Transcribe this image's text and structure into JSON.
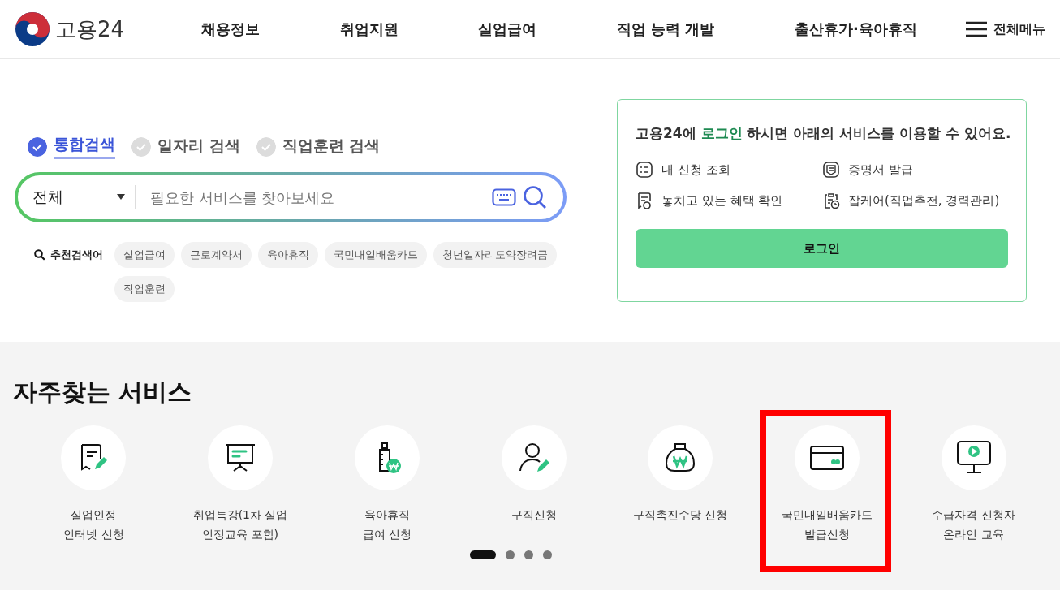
{
  "header": {
    "logo_text": "고용24",
    "nav": [
      "채용정보",
      "취업지원",
      "실업급여",
      "직업 능력 개발",
      "출산휴가·육아휴직"
    ],
    "menu_label": "전체메뉴"
  },
  "search": {
    "tabs": [
      {
        "label": "통합검색",
        "selected": true
      },
      {
        "label": "일자리 검색",
        "selected": false
      },
      {
        "label": "직업훈련 검색",
        "selected": false
      }
    ],
    "category": "전체",
    "placeholder": "필요한 서비스를 찾아보세요",
    "recommended_label": "추천검색어",
    "keywords": [
      "실업급여",
      "근로계약서",
      "육아휴직",
      "국민내일배움카드",
      "청년일자리도약장려금",
      "직업훈련"
    ]
  },
  "login_card": {
    "message": "고용24에 **로그인** 하시면 아래의 서비스를 이용할 수 있어요.",
    "services": [
      {
        "kind": "list",
        "label": "내 신청 조회"
      },
      {
        "kind": "certificate",
        "label": "증명서 발급"
      },
      {
        "kind": "benefit",
        "label": "놓치고 있는 혜택 확인"
      },
      {
        "kind": "clipboard",
        "label": "잡케어(직업추천, 경력관리)"
      }
    ],
    "button": "로그인"
  },
  "frequent_services": {
    "title": "자주찾는 서비스",
    "items": [
      {
        "kind": "document",
        "label": "실업인정\n인터넷 신청",
        "highlighted": false
      },
      {
        "kind": "presentation",
        "label": "취업특강(1차 실업\n인정교육 포함)",
        "highlighted": false
      },
      {
        "kind": "bottle",
        "label": "육아휴직\n급여 신청",
        "highlighted": false
      },
      {
        "kind": "person",
        "label": "구직신청",
        "highlighted": false
      },
      {
        "kind": "moneybag",
        "label": "구직촉진수당 신청",
        "highlighted": false
      },
      {
        "kind": "card",
        "label": "국민내일배움카드\n발급신청",
        "highlighted": true
      },
      {
        "kind": "monitor",
        "label": "수급자격 신청자\n온라인 교육",
        "highlighted": false
      }
    ],
    "pager": [
      {
        "selected": true
      },
      {
        "selected": false
      },
      {
        "selected": false
      },
      {
        "selected": false
      }
    ]
  }
}
